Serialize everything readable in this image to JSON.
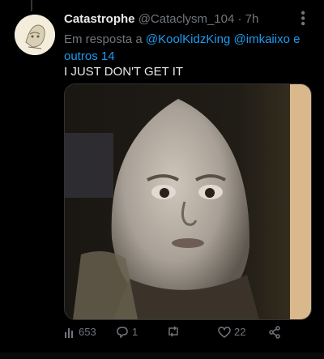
{
  "tweet": {
    "display_name": "Catastrophe",
    "handle": "@Cataclysm_104",
    "separator": "·",
    "time": "7h",
    "reply_prefix": "Em resposta a",
    "reply_mention_1": "@KoolKidzKing",
    "reply_mention_2": "@imkaiixo",
    "reply_suffix": "e outros 14",
    "text": "I JUST DON'T GET IT"
  },
  "actions": {
    "views": "653",
    "replies": "1",
    "retweets": "",
    "likes": "22"
  },
  "icons": {
    "more": "more-icon",
    "views": "analytics-icon",
    "reply": "reply-icon",
    "retweet": "retweet-icon",
    "like": "heart-icon",
    "share": "share-icon"
  },
  "colors": {
    "background": "#000000",
    "text": "#e7e9ea",
    "muted": "#71767b",
    "link": "#1d9bf0"
  }
}
